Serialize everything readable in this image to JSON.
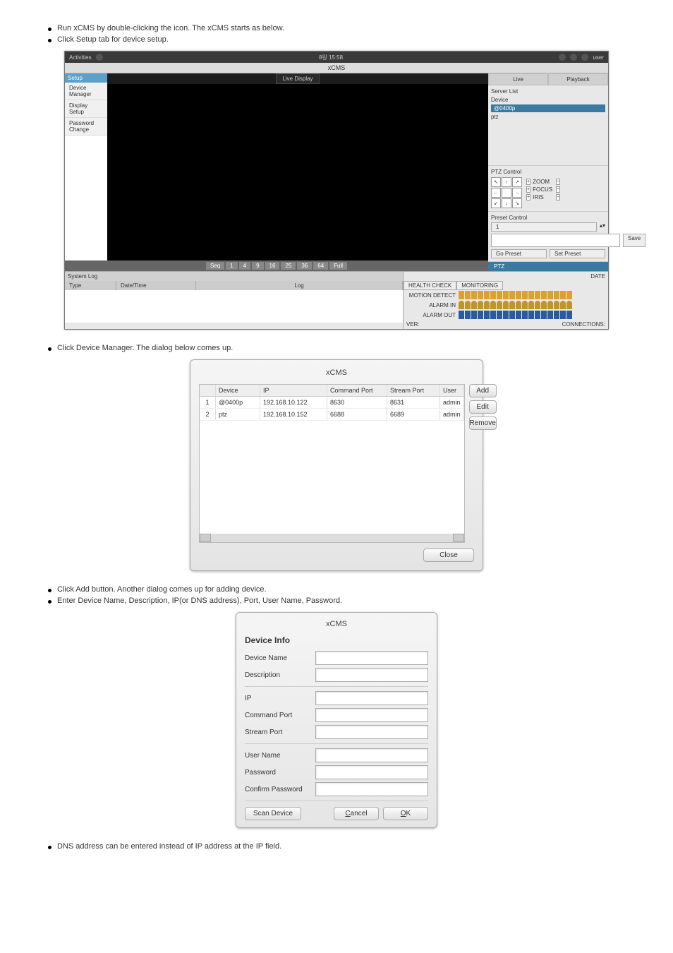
{
  "bullets": {
    "b1": "Run xCMS by double-clicking the icon. The xCMS starts as below.",
    "b2": "Click Setup tab for device setup.",
    "b3": "Click Device Manager. The dialog below comes up.",
    "b4": "Click Add button. Another dialog comes up for adding device.",
    "b5": "Enter Device Name, Description, IP(or DNS address), Port, User Name, Password.",
    "b6": "DNS address can be entered instead of IP address at the IP field."
  },
  "cms": {
    "topLeft": "Activities",
    "topTime": "8욍 15:58",
    "userLabel": "user",
    "title": "xCMS",
    "setupTab": "Setup",
    "menu": [
      "Device Manager",
      "Display Setup",
      "Password Change"
    ],
    "liveDisplay": "Live Display",
    "gridButtons": [
      "Seq",
      "1",
      "4",
      "9",
      "16",
      "25",
      "36",
      "64",
      "Full"
    ],
    "rightTabs": {
      "live": "Live",
      "playback": "Playback"
    },
    "serverList": "Server List",
    "deviceLabel": "Device",
    "devices": [
      "@0400p",
      "ptz"
    ],
    "ptzControl": "PTZ Control",
    "ptzRows": {
      "zoom": "ZOOM",
      "focus": "FOCUS",
      "iris": "IRIS"
    },
    "presetControl": "Preset Control",
    "presetNumber": "1",
    "saveBtn": "Save",
    "goPreset": "Go Preset",
    "setPreset": "Set Preset",
    "ptzBottomTab": "PTZ",
    "systemLog": "System Log",
    "logCols": {
      "type": "Type",
      "datetime": "Date/Time",
      "log": "Log"
    },
    "health": {
      "date": "DATE",
      "tab1": "HEALTH CHECK",
      "tab2": "MONITORING",
      "rows": [
        "MOTION DETECT",
        "ALARM IN",
        "ALARM OUT"
      ],
      "ver": "VER:",
      "connections": "CONNECTIONS:"
    }
  },
  "dlg1": {
    "title": "xCMS",
    "headers": [
      "",
      "Device",
      "IP",
      "Command Port",
      "Stream Port",
      "User"
    ],
    "rows": [
      {
        "n": "1",
        "device": "@0400p",
        "ip": "192.168.10.122",
        "cmd": "8630",
        "stream": "8631",
        "user": "admin"
      },
      {
        "n": "2",
        "device": "ptz",
        "ip": "192.168.10.152",
        "cmd": "6688",
        "stream": "6689",
        "user": "admin"
      }
    ],
    "buttons": {
      "add": "Add",
      "edit": "Edit",
      "remove": "Remove",
      "close": "Close"
    }
  },
  "dlg2": {
    "title": "xCMS",
    "heading": "Device Info",
    "fields": {
      "deviceName": "Device Name",
      "description": "Description",
      "ip": "IP",
      "commandPort": "Command Port",
      "streamPort": "Stream Port",
      "userName": "User Name",
      "password": "Password",
      "confirmPassword": "Confirm Password"
    },
    "buttons": {
      "scan": "Scan Device",
      "cancel": "ancel",
      "cancelAccel": "C",
      "ok": "K",
      "okAccel": "O"
    }
  }
}
